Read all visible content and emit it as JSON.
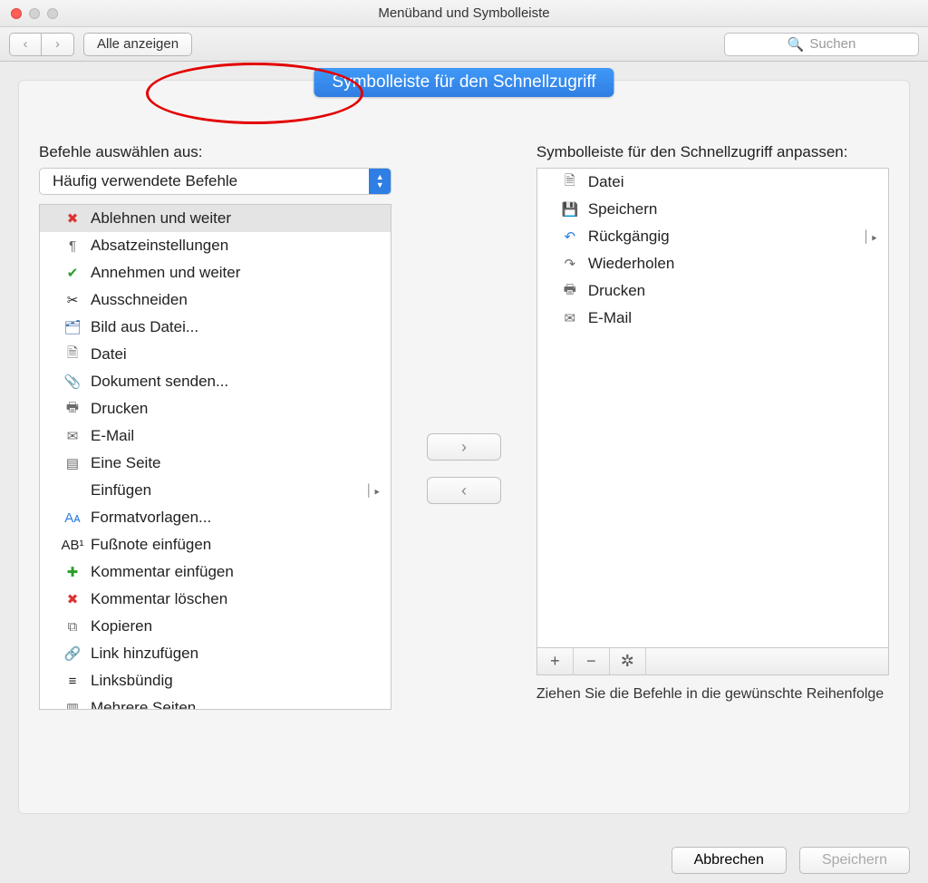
{
  "window": {
    "title": "Menüband und Symbolleiste"
  },
  "toolbar": {
    "show_all": "Alle anzeigen",
    "search_placeholder": "Suchen"
  },
  "tab": {
    "label": "Symbolleiste für den Schnellzugriff"
  },
  "left": {
    "label": "Befehle auswählen aus:",
    "select_value": "Häufig verwendete Befehle",
    "items": [
      {
        "icon": "reject-icon",
        "glyph": "✖",
        "cls": "c-red",
        "label": "Ablehnen und weiter",
        "selected": true
      },
      {
        "icon": "paragraph-icon",
        "glyph": "¶",
        "cls": "c-gray",
        "label": "Absatzeinstellungen"
      },
      {
        "icon": "accept-icon",
        "glyph": "✔",
        "cls": "c-green",
        "label": "Annehmen und weiter"
      },
      {
        "icon": "cut-icon",
        "glyph": "✂",
        "cls": "",
        "label": "Ausschneiden"
      },
      {
        "icon": "image-file-icon",
        "glyph": "🗂",
        "cls": "c-dkblue",
        "label": "Bild aus Datei..."
      },
      {
        "icon": "file-icon",
        "glyph": "🗎",
        "cls": "c-gray",
        "label": "Datei"
      },
      {
        "icon": "attachment-icon",
        "glyph": "📎",
        "cls": "c-gray",
        "label": "Dokument senden..."
      },
      {
        "icon": "print-icon",
        "glyph": "🖶",
        "cls": "c-gray",
        "label": "Drucken"
      },
      {
        "icon": "email-icon",
        "glyph": "✉",
        "cls": "c-gray",
        "label": "E-Mail"
      },
      {
        "icon": "one-page-icon",
        "glyph": "▤",
        "cls": "c-gray",
        "label": "Eine Seite"
      },
      {
        "icon": "paste-icon",
        "glyph": " ",
        "cls": "",
        "label": "Einfügen",
        "submenu": true
      },
      {
        "icon": "styles-icon",
        "glyph": "Aᴀ",
        "cls": "c-blue",
        "label": "Formatvorlagen..."
      },
      {
        "icon": "footnote-icon",
        "glyph": "AB¹",
        "cls": "",
        "label": "Fußnote einfügen"
      },
      {
        "icon": "comment-add-icon",
        "glyph": "✚",
        "cls": "c-green",
        "label": "Kommentar einfügen"
      },
      {
        "icon": "comment-delete-icon",
        "glyph": "✖",
        "cls": "c-red",
        "label": "Kommentar löschen"
      },
      {
        "icon": "copy-icon",
        "glyph": "⧉",
        "cls": "c-gray",
        "label": "Kopieren"
      },
      {
        "icon": "link-icon",
        "glyph": "🔗",
        "cls": "c-gray",
        "label": "Link hinzufügen"
      },
      {
        "icon": "align-left-icon",
        "glyph": "≡",
        "cls": "",
        "label": "Linksbündig"
      },
      {
        "icon": "multi-page-icon",
        "glyph": "▥",
        "cls": "c-gray",
        "label": "Mehrere Seiten"
      }
    ]
  },
  "right": {
    "label": "Symbolleiste für den Schnellzugriff anpassen:",
    "items": [
      {
        "icon": "file-icon",
        "glyph": "🗎",
        "cls": "c-gray",
        "label": "Datei"
      },
      {
        "icon": "save-icon",
        "glyph": "💾",
        "cls": "c-purple",
        "label": "Speichern"
      },
      {
        "icon": "undo-icon",
        "glyph": "↶",
        "cls": "c-blue",
        "label": "Rückgängig",
        "submenu": true
      },
      {
        "icon": "redo-icon",
        "glyph": "↷",
        "cls": "c-gray",
        "label": "Wiederholen"
      },
      {
        "icon": "print-icon",
        "glyph": "🖶",
        "cls": "c-gray",
        "label": "Drucken"
      },
      {
        "icon": "email-icon",
        "glyph": "✉",
        "cls": "c-gray",
        "label": "E-Mail"
      }
    ],
    "hint": "Ziehen Sie die Befehle in die gewünschte Reihenfolge"
  },
  "footer": {
    "cancel": "Abbrechen",
    "save": "Speichern"
  }
}
